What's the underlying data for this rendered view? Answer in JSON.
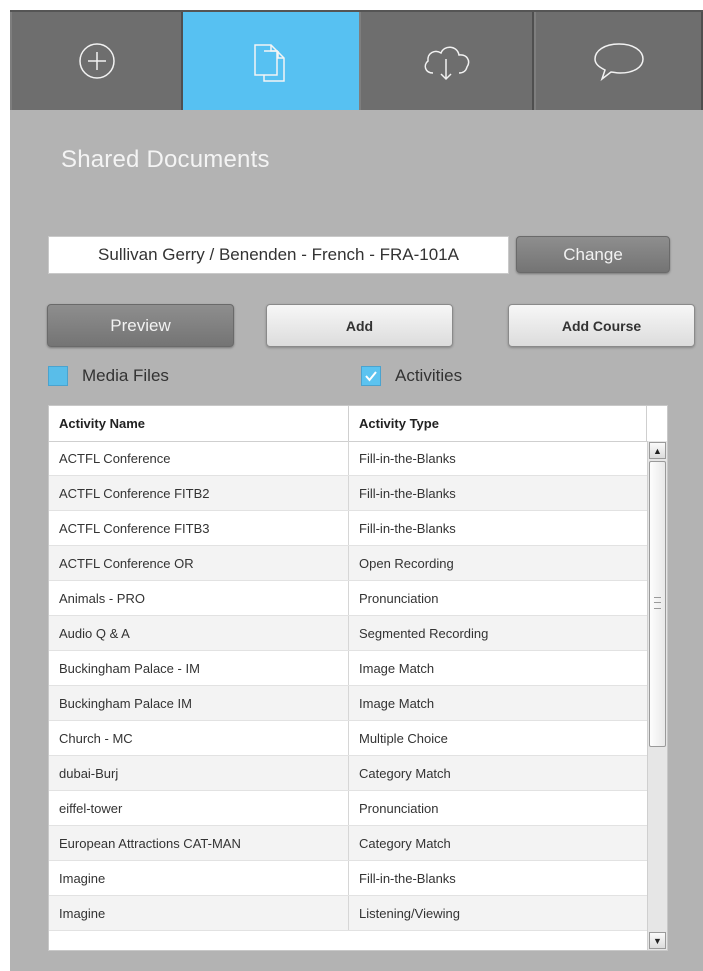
{
  "tabs": [
    {
      "icon": "add-circle-icon",
      "active": false
    },
    {
      "icon": "documents-icon",
      "active": true
    },
    {
      "icon": "cloud-download-icon",
      "active": false
    },
    {
      "icon": "speech-bubble-icon",
      "active": false
    }
  ],
  "page_title": "Shared Documents",
  "course": {
    "value": "Sullivan Gerry / Benenden - French - FRA-101A",
    "change_label": "Change"
  },
  "actions": {
    "preview_label": "Preview",
    "add_label": "Add",
    "add_course_label": "Add Course"
  },
  "filters": {
    "media_files": {
      "label": "Media Files",
      "checked": false
    },
    "activities": {
      "label": "Activities",
      "checked": true
    }
  },
  "table": {
    "headers": [
      "Activity Name",
      "Activity Type"
    ],
    "rows": [
      {
        "name": "ACTFL Conference",
        "type": "Fill-in-the-Blanks"
      },
      {
        "name": "ACTFL Conference FITB2",
        "type": "Fill-in-the-Blanks"
      },
      {
        "name": "ACTFL Conference FITB3",
        "type": "Fill-in-the-Blanks"
      },
      {
        "name": "ACTFL Conference OR",
        "type": "Open Recording"
      },
      {
        "name": "Animals - PRO",
        "type": "Pronunciation"
      },
      {
        "name": "Audio Q & A",
        "type": "Segmented Recording"
      },
      {
        "name": "Buckingham Palace - IM",
        "type": "Image Match"
      },
      {
        "name": "Buckingham Palace IM",
        "type": "Image Match"
      },
      {
        "name": "Church - MC",
        "type": "Multiple Choice"
      },
      {
        "name": "dubai-Burj",
        "type": "Category Match"
      },
      {
        "name": "eiffel-tower",
        "type": "Pronunciation"
      },
      {
        "name": "European Attractions CAT-MAN",
        "type": "Category Match"
      },
      {
        "name": "Imagine",
        "type": "Fill-in-the-Blanks"
      },
      {
        "name": "Imagine",
        "type": "Listening/Viewing"
      }
    ]
  },
  "colors": {
    "accent": "#57c1f2",
    "panel_bg": "#b3b3b3",
    "tab_bg": "#6e6e6e"
  }
}
